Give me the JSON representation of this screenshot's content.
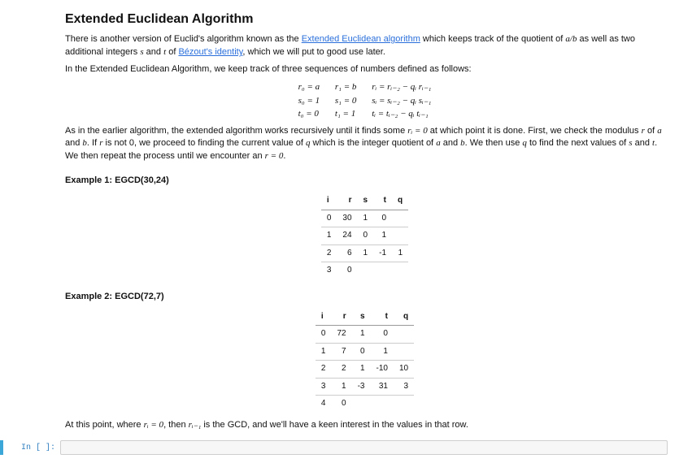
{
  "title": "Extended Euclidean Algorithm",
  "intro_p1_a": "There is another version of Euclid's algorithm known as the ",
  "intro_link1": "Extended Euclidean algorithm",
  "intro_p1_b": " which keeps track of the quotient of ",
  "intro_frac": "a/b",
  "intro_p1_c": " as well as two additional integers ",
  "intro_p1_s": "s",
  "intro_p1_and": " and ",
  "intro_p1_t": "t",
  "intro_p1_of": " of ",
  "intro_link2": "Bézout's identity",
  "intro_p1_d": ", which we will put to good use later.",
  "intro_p2": "In the Extended Euclidean Algorithm, we keep track of three sequences of numbers defined as follows:",
  "math_col1": "r₀ = a\ns₀ = 1\nt₀ = 0",
  "math_col2": "r₁ = b\ns₁ = 0\nt₁ = 1",
  "math_col3": "rᵢ = rᵢ₋₂ − qᵢ rᵢ₋₁\nsᵢ = sᵢ₋₂ − qᵢ sᵢ₋₁\ntᵢ = tᵢ₋₂ − qᵢ tᵢ₋₁",
  "para2_a": "As in the earlier algorithm, the extended algorithm works recursively until it finds some ",
  "para2_ri": "rᵢ = 0",
  "para2_b": " at which point it is done. First, we check the modulus ",
  "para2_r": "r",
  "para2_c": " of ",
  "para2_av": "a",
  "para2_d": " and ",
  "para2_bv": "b",
  "para2_e": ". If ",
  "para2_r2": "r",
  "para2_f": " is not 0, we proceed to finding the current value of ",
  "para2_q": "q",
  "para2_g": " which is the integer quotient of ",
  "para2_a2": "a",
  "para2_h": " and ",
  "para2_b2": "b",
  "para2_i": ". We then use ",
  "para2_q2": "q",
  "para2_j": " to find the next values of ",
  "para2_s": "s",
  "para2_k": " and ",
  "para2_t": "t",
  "para2_l": ". We then repeat the process until we encounter an ",
  "para2_r0": "r = 0",
  "para2_m": ".",
  "example1_label": "Example 1: EGCD(30,24)",
  "example2_label": "Example 2: EGCD(72,7)",
  "hdr_i": "i",
  "hdr_r": "r",
  "hdr_s": "s",
  "hdr_t": "t",
  "hdr_q": "q",
  "t1": {
    "r0_i": "0",
    "r0_r": "30",
    "r0_s": "1",
    "r0_t": "0",
    "r0_q": "",
    "r1_i": "1",
    "r1_r": "24",
    "r1_s": "0",
    "r1_t": "1",
    "r1_q": "",
    "r2_i": "2",
    "r2_r": "6",
    "r2_s": "1",
    "r2_t": "-1",
    "r2_q": "1",
    "r3_i": "3",
    "r3_r": "0",
    "r3_s": "",
    "r3_t": "",
    "r3_q": ""
  },
  "t2": {
    "r0_i": "0",
    "r0_r": "72",
    "r0_s": "1",
    "r0_t": "0",
    "r0_q": "",
    "r1_i": "1",
    "r1_r": "7",
    "r1_s": "0",
    "r1_t": "1",
    "r1_q": "",
    "r2_i": "2",
    "r2_r": "2",
    "r2_s": "1",
    "r2_t": "-10",
    "r2_q": "10",
    "r3_i": "3",
    "r3_r": "1",
    "r3_s": "-3",
    "r3_t": "31",
    "r3_q": "3",
    "r4_i": "4",
    "r4_r": "0",
    "r4_s": "",
    "r4_t": "",
    "r4_q": ""
  },
  "concl_a": "At this point, where ",
  "concl_ri0": "rᵢ = 0",
  "concl_b": ", then ",
  "concl_rim1": "rᵢ₋₁",
  "concl_c": " is the GCD, and we'll have a keen interest in the values in that row.",
  "prompt": "In [ ]:",
  "code_value": ""
}
